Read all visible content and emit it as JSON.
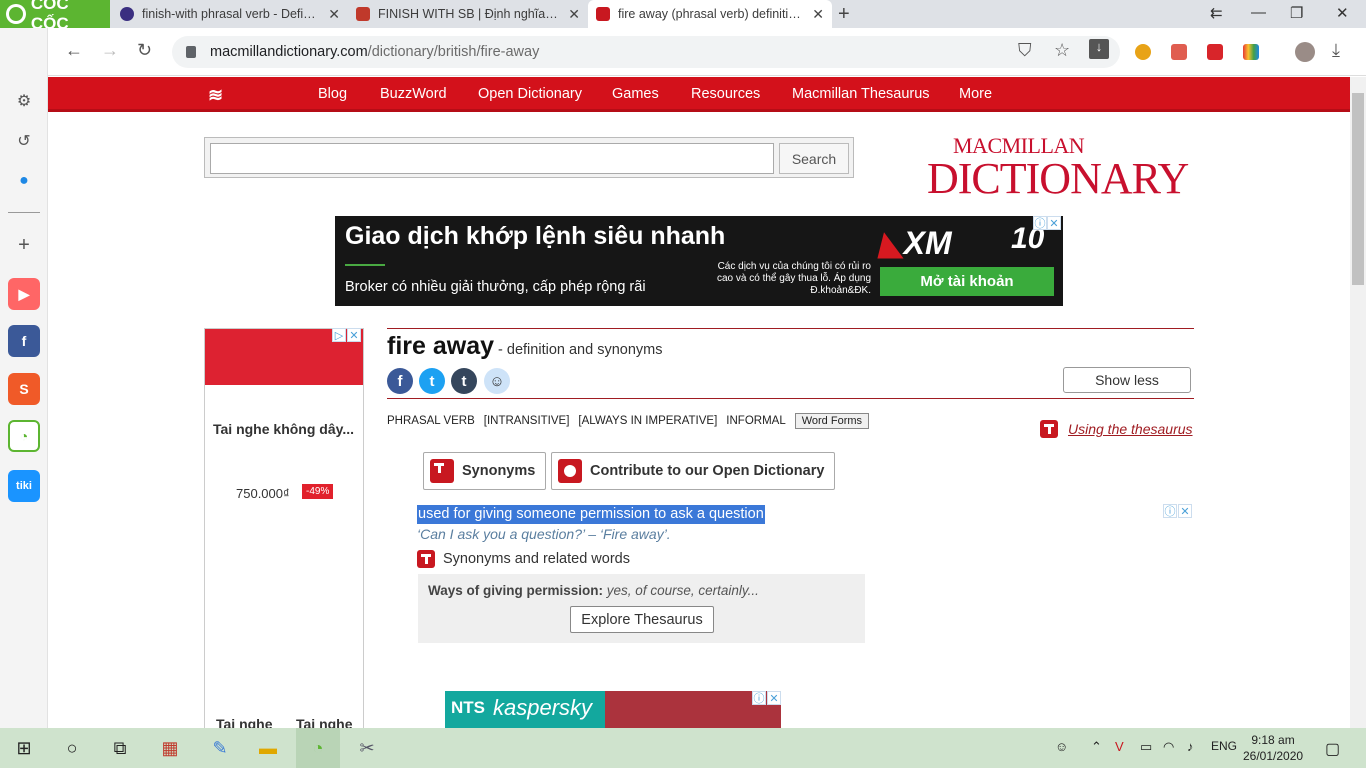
{
  "browser": {
    "brand": "CỐC CỐC",
    "tabs": [
      {
        "title": "finish-with phrasal verb - Definition",
        "favicon_color": "#3a2e80"
      },
      {
        "title": "FINISH WITH SB | Định nghĩa trong",
        "favicon_color": "#c0392b"
      },
      {
        "title": "fire away (phrasal verb) definition a",
        "favicon_color": "#c81820"
      }
    ],
    "new_tab": "+",
    "url_domain": "macmillandictionary.com",
    "url_path": "/dictionary/british/fire-away"
  },
  "site": {
    "nav": [
      "Blog",
      "BuzzWord",
      "Open Dictionary",
      "Games",
      "Resources",
      "Macmillan Thesaurus",
      "More"
    ],
    "search_placeholder": "",
    "search_button": "Search",
    "logo_line1": "MACMILLAN",
    "logo_line2": "DICTIONARY"
  },
  "ads": {
    "xm_headline": "Giao dịch khớp lệnh siêu nhanh",
    "xm_sub": "Broker có nhiều giải thưởng, cấp phép rộng rãi",
    "xm_small": "Các dịch vụ của chúng tôi có rủi ro cao và có thể gây thua lỗ. Áp dụng Đ.khoản&ĐK.",
    "xm_brand": "XM",
    "xm_years": "10",
    "xm_cta": "Mở tài khoản",
    "left_product": "Tai nghe không dây...",
    "left_price": "750.000₫",
    "left_discount": "-49%",
    "left_bottom_1": "Tai nghe",
    "left_bottom_2": "Tai nghe",
    "kas_nts": "NTS",
    "kas_brand": "kaspersky"
  },
  "entry": {
    "headword": "fire away",
    "subtitle": " - definition and synonyms",
    "show_less": "Show less",
    "grammar": [
      "PHRASAL VERB",
      "[INTRANSITIVE]",
      "[ALWAYS IN IMPERATIVE]",
      "INFORMAL"
    ],
    "word_forms": "Word Forms",
    "using_thesaurus": "Using the thesaurus",
    "synonyms_btn": "Synonyms",
    "contribute_btn": "Contribute to our Open Dictionary",
    "definition": "used for giving someone permission to ask a question",
    "example": "‘Can I ask you a question?’ – ‘Fire away’.",
    "syn_related": "Synonyms and related words",
    "ways_label": "Ways of giving permission:",
    "ways_items": "yes, of course, certainly...",
    "explore": "Explore Thesaurus"
  },
  "taskbar": {
    "lang": "ENG",
    "time": "9:18 am",
    "date": "26/01/2020"
  },
  "colors": {
    "brand_red": "#d3111b",
    "coccoc_green": "#5cb531",
    "highlight": "#3b78d8"
  }
}
